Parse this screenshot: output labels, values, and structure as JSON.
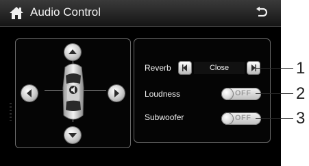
{
  "header": {
    "title": "Audio Control",
    "home_icon": "home-icon",
    "back_icon": "back-arrow-icon"
  },
  "balance_fader": {
    "up_icon": "up-arrow-icon",
    "down_icon": "down-arrow-icon",
    "left_icon": "left-arrow-icon",
    "right_icon": "right-arrow-icon",
    "car_icon": "car-top-view-icon"
  },
  "settings": {
    "reverb": {
      "label": "Reverb",
      "value": "Close"
    },
    "loudness": {
      "label": "Loudness",
      "state": "OFF"
    },
    "subwoofer": {
      "label": "Subwoofer",
      "state": "OFF"
    }
  },
  "callouts": [
    "1",
    "2",
    "3"
  ]
}
